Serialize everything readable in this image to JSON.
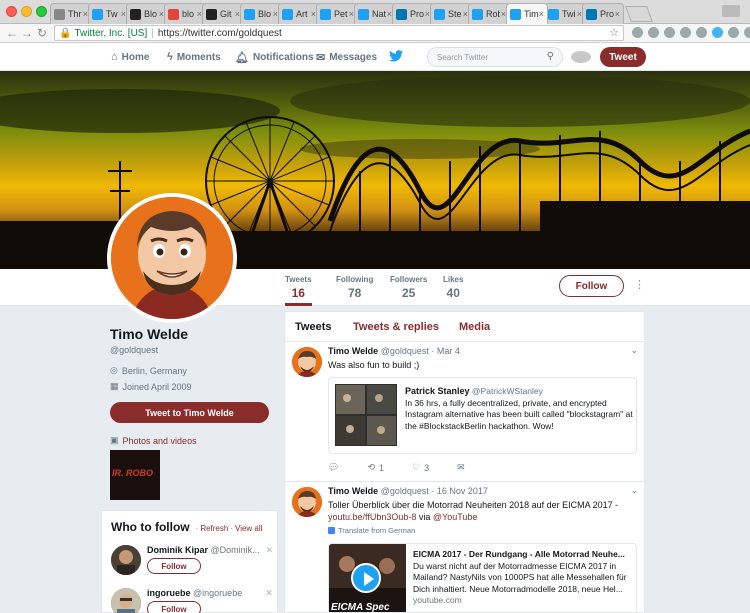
{
  "browser": {
    "tabs": [
      {
        "label": "Thr",
        "icon": "page-icon",
        "color": "#888888"
      },
      {
        "label": "Tw",
        "icon": "twitter-icon",
        "color": "#1da1f2"
      },
      {
        "label": "Blo",
        "icon": "medium-icon",
        "color": "#222222"
      },
      {
        "label": "blo",
        "icon": "s-icon",
        "color": "#e0463c"
      },
      {
        "label": "Git",
        "icon": "github-icon",
        "color": "#222222"
      },
      {
        "label": "Blo",
        "icon": "twitter-icon",
        "color": "#1da1f2"
      },
      {
        "label": "Art",
        "icon": "twitter-icon",
        "color": "#1da1f2"
      },
      {
        "label": "Pet",
        "icon": "twitter-icon",
        "color": "#1da1f2"
      },
      {
        "label": "Nat",
        "icon": "twitter-icon",
        "color": "#1da1f2"
      },
      {
        "label": "Pro",
        "icon": "linkedin-icon",
        "color": "#0077b5"
      },
      {
        "label": "Ste",
        "icon": "twitter-icon",
        "color": "#1da1f2"
      },
      {
        "label": "Rob",
        "icon": "twitter-icon",
        "color": "#1da1f2"
      },
      {
        "label": "Tim",
        "icon": "twitter-icon",
        "color": "#1da1f2",
        "active": true
      },
      {
        "label": "Twi",
        "icon": "twitter-icon",
        "color": "#1da1f2"
      },
      {
        "label": "Pro",
        "icon": "linkedin-icon",
        "color": "#0077b5"
      }
    ],
    "secure_label": "Twitter, Inc. [US]",
    "url": "https://twitter.com/goldquest"
  },
  "nav": {
    "home": "Home",
    "moments": "Moments",
    "notifications": "Notifications",
    "messages": "Messages",
    "search_placeholder": "Search Twitter",
    "tweet_button": "Tweet"
  },
  "profile": {
    "name": "Timo Welde",
    "handle": "@goldquest",
    "location": "Berlin, Germany",
    "joined": "Joined April 2009",
    "tweet_to": "Tweet to Timo Welde",
    "photos_label": "Photos and videos",
    "thumb_text": "IR. ROBO",
    "follow_button": "Follow",
    "accent": "#8b2c2c"
  },
  "stats": [
    {
      "label": "Tweets",
      "value": "16"
    },
    {
      "label": "Following",
      "value": "78"
    },
    {
      "label": "Followers",
      "value": "25"
    },
    {
      "label": "Likes",
      "value": "40"
    }
  ],
  "timeline": {
    "tabs": [
      "Tweets",
      "Tweets & replies",
      "Media"
    ],
    "tweets": [
      {
        "name": "Timo Welde",
        "handle": "@goldquest",
        "date": "· Mar 4",
        "text": "Was also fun to build ;)",
        "card_name": "Patrick Stanley",
        "card_handle": "@PatrickWStanley",
        "card_text": "In 36 hrs, a fully decentralized, private, and encrypted Instagram alternative has been built called \"blockstagram\" at the #BlockstackBerlin hackathon. Wow!",
        "retweets": "1",
        "likes": "3"
      },
      {
        "name": "Timo Welde",
        "handle": "@goldquest",
        "date": "· 16 Nov 2017",
        "text_before": "Toller Überblick über die Motorrad Neuheiten 2018 auf der EICMA 2017 - ",
        "link": "youtu.be/ffUbn3Oub-8",
        "via": " via ",
        "via_handle": "@YouTube",
        "translate": "Translate from German",
        "card_title": "EICMA 2017 - Der Rundgang - Alle Motorrad Neuhe...",
        "card_text": "Du warst nicht auf der Motorradmesse EICMA 2017 in Mailand? NastyNils von 1000PS hat alle Messehallen für Dich inhaltiert. Neue Motorradmodelle 2018, neue Hel...",
        "card_domain": "youtube.com",
        "card_overlay": "EICMA Spec"
      }
    ]
  },
  "who_to_follow": {
    "title": "Who to follow",
    "refresh": "Refresh",
    "view_all": "View all",
    "dot": "·",
    "users": [
      {
        "name": "Dominik Kipar",
        "handle": "@Dominik..."
      },
      {
        "name": "ingoruebe",
        "handle": "@ingoruebe"
      }
    ],
    "follow_label": "Follow"
  }
}
